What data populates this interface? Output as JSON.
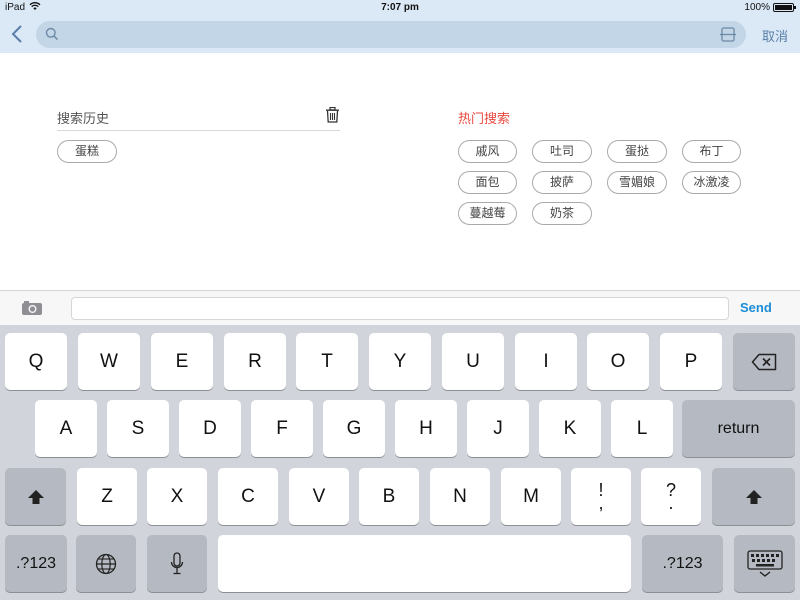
{
  "status_bar": {
    "device": "iPad",
    "time": "7:07 pm",
    "battery": "100%"
  },
  "nav": {
    "search_placeholder": "",
    "cancel_label": "取消"
  },
  "history": {
    "title": "搜索历史",
    "items": [
      "蛋糕"
    ]
  },
  "hot": {
    "title": "热门搜索",
    "items": [
      "戚风",
      "吐司",
      "蛋挞",
      "布丁",
      "面包",
      "披萨",
      "雪媚娘",
      "冰激凌",
      "蔓越莓",
      "奶茶"
    ]
  },
  "accessory": {
    "send_label": "Send"
  },
  "keyboard": {
    "row1": [
      "Q",
      "W",
      "E",
      "R",
      "T",
      "Y",
      "U",
      "I",
      "O",
      "P"
    ],
    "row2": [
      "A",
      "S",
      "D",
      "F",
      "G",
      "H",
      "J",
      "K",
      "L"
    ],
    "return_label": "return",
    "row3": [
      "Z",
      "X",
      "C",
      "V",
      "B",
      "N",
      "M"
    ],
    "punct1": [
      "!",
      ","
    ],
    "punct2": [
      "?",
      "."
    ],
    "numbers_label": ".?123"
  },
  "colors": {
    "accent": "#1b8cd6",
    "hot_title": "#e84a3f",
    "nav_bg": "#dbe9f6",
    "keyboard_bg": "#d1d5db"
  }
}
